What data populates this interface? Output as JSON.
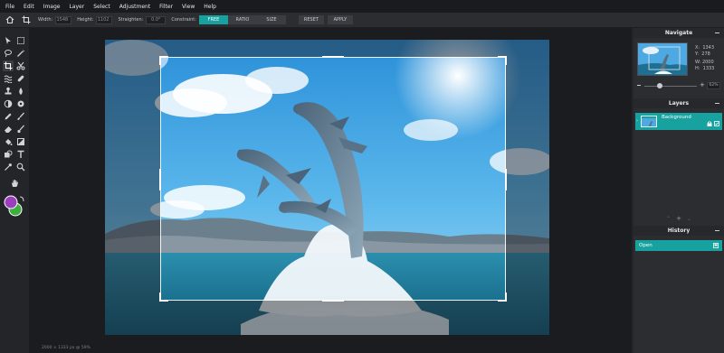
{
  "menu": [
    "File",
    "Edit",
    "Image",
    "Layer",
    "Select",
    "Adjustment",
    "Filter",
    "View",
    "Help"
  ],
  "options": {
    "width_label": "Width:",
    "width_value": "1548",
    "height_label": "Height:",
    "height_value": "1102",
    "straighten_label": "Straighten:",
    "straighten_value": "0.0°",
    "constraint_label": "Constraint:",
    "constraint_options": [
      "FREE",
      "RATIO",
      "SIZE"
    ],
    "constraint_selected": "FREE",
    "reset_label": "RESET",
    "apply_label": "APPLY"
  },
  "tools": [
    "move-tool",
    "marquee-tool",
    "lasso-tool",
    "magic-wand-tool",
    "crop-tool",
    "cut-tool",
    "liquify-tool",
    "healing-brush-tool",
    "stamp-tool",
    "blur-tool",
    "dodge-tool",
    "sponge-tool",
    "pencil-tool",
    "brush-tool",
    "eraser-tool",
    "color-replace-tool",
    "bucket-tool",
    "gradient-tool",
    "shape-tool",
    "text-tool",
    "eyedropper-tool",
    "zoom-tool",
    "hand-tool"
  ],
  "colors": {
    "foreground": "#9b3fbf",
    "background": "#3fae3f",
    "accent": "#17a2a0"
  },
  "statusbar": {
    "text": "2000 × 1333 px @ 59%"
  },
  "navigate": {
    "title": "Navigate",
    "x_label": "X:",
    "x_value": "1343",
    "y_label": "Y:",
    "y_value": "278",
    "w_label": "W:",
    "w_value": "2000",
    "h_label": "H:",
    "h_value": "1333",
    "zoom": "62%",
    "zoom_fraction": 0.3
  },
  "layers": {
    "title": "Layers",
    "items": [
      {
        "name": "Background",
        "locked": true,
        "visible": true
      }
    ]
  },
  "history": {
    "title": "History",
    "items": [
      "Open"
    ]
  }
}
